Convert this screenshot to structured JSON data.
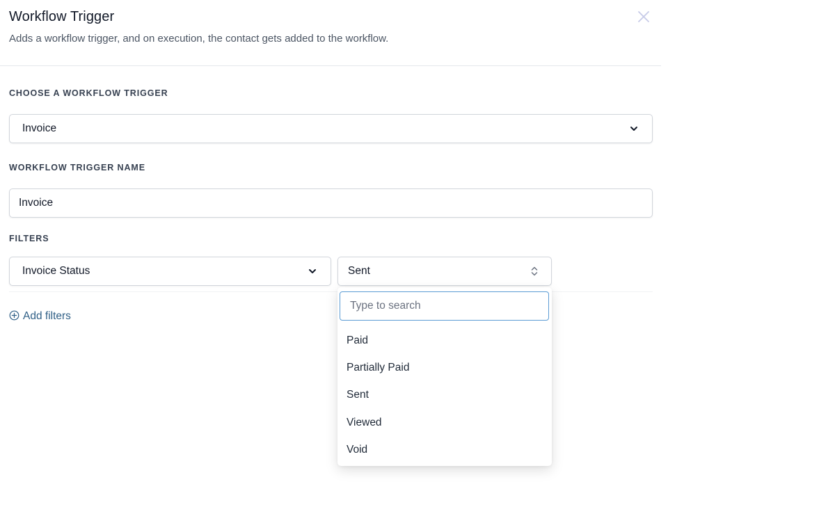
{
  "header": {
    "title": "Workflow Trigger",
    "subtitle": "Adds a workflow trigger, and on execution, the contact gets added to the workflow."
  },
  "trigger": {
    "label": "CHOOSE A WORKFLOW TRIGGER",
    "selected": "Invoice"
  },
  "trigger_name": {
    "label": "WORKFLOW TRIGGER NAME",
    "value": "Invoice"
  },
  "filters": {
    "label": "FILTERS",
    "field_selected": "Invoice Status",
    "value_selected": "Sent",
    "add_label": "Add filters"
  },
  "dropdown": {
    "search_placeholder": "Type to search",
    "options": [
      "Paid",
      "Partially Paid",
      "Sent",
      "Viewed",
      "Void"
    ]
  },
  "colors": {
    "link": "#2f5f86",
    "focus_border": "#5a9bd4",
    "close_icon": "#c7cbe8"
  }
}
